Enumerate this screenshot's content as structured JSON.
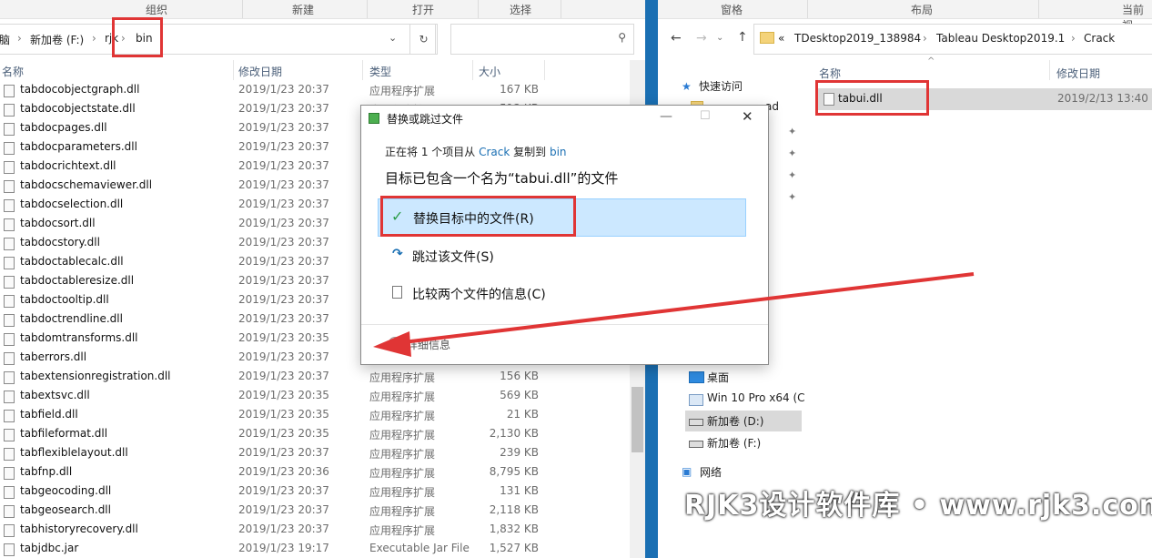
{
  "left_window": {
    "ribbon": [
      "组织",
      "新建",
      "打开",
      "选择"
    ],
    "breadcrumb": [
      "脑",
      "新加卷 (F:)",
      "rjk",
      "bin"
    ],
    "columns": {
      "name": "名称",
      "date": "修改日期",
      "type": "类型",
      "size": "大小"
    },
    "files": [
      {
        "name": "tabdocobjectgraph.dll",
        "date": "2019/1/23 20:37",
        "type": "应用程序扩展",
        "size": "167 KB"
      },
      {
        "name": "tabdocobjectstate.dll",
        "date": "2019/1/23 20:37",
        "type": "应用程序扩展",
        "size": "512 KB"
      },
      {
        "name": "tabdocpages.dll",
        "date": "2019/1/23 20:37",
        "type": "",
        "size": ""
      },
      {
        "name": "tabdocparameters.dll",
        "date": "2019/1/23 20:37",
        "type": "",
        "size": ""
      },
      {
        "name": "tabdocrichtext.dll",
        "date": "2019/1/23 20:37",
        "type": "",
        "size": ""
      },
      {
        "name": "tabdocschemaviewer.dll",
        "date": "2019/1/23 20:37",
        "type": "",
        "size": ""
      },
      {
        "name": "tabdocselection.dll",
        "date": "2019/1/23 20:37",
        "type": "",
        "size": ""
      },
      {
        "name": "tabdocsort.dll",
        "date": "2019/1/23 20:37",
        "type": "",
        "size": ""
      },
      {
        "name": "tabdocstory.dll",
        "date": "2019/1/23 20:37",
        "type": "",
        "size": ""
      },
      {
        "name": "tabdoctablecalc.dll",
        "date": "2019/1/23 20:37",
        "type": "",
        "size": ""
      },
      {
        "name": "tabdoctableresize.dll",
        "date": "2019/1/23 20:37",
        "type": "",
        "size": ""
      },
      {
        "name": "tabdoctooltip.dll",
        "date": "2019/1/23 20:37",
        "type": "",
        "size": ""
      },
      {
        "name": "tabdoctrendline.dll",
        "date": "2019/1/23 20:37",
        "type": "",
        "size": ""
      },
      {
        "name": "tabdomtransforms.dll",
        "date": "2019/1/23 20:35",
        "type": "",
        "size": ""
      },
      {
        "name": "taberrors.dll",
        "date": "2019/1/23 20:37",
        "type": "",
        "size": ""
      },
      {
        "name": "tabextensionregistration.dll",
        "date": "2019/1/23 20:37",
        "type": "应用程序扩展",
        "size": "156 KB"
      },
      {
        "name": "tabextsvc.dll",
        "date": "2019/1/23 20:35",
        "type": "应用程序扩展",
        "size": "569 KB"
      },
      {
        "name": "tabfield.dll",
        "date": "2019/1/23 20:35",
        "type": "应用程序扩展",
        "size": "21 KB"
      },
      {
        "name": "tabfileformat.dll",
        "date": "2019/1/23 20:35",
        "type": "应用程序扩展",
        "size": "2,130 KB"
      },
      {
        "name": "tabflexiblelayout.dll",
        "date": "2019/1/23 20:37",
        "type": "应用程序扩展",
        "size": "239 KB"
      },
      {
        "name": "tabfnp.dll",
        "date": "2019/1/23 20:36",
        "type": "应用程序扩展",
        "size": "8,795 KB"
      },
      {
        "name": "tabgeocoding.dll",
        "date": "2019/1/23 20:37",
        "type": "应用程序扩展",
        "size": "131 KB"
      },
      {
        "name": "tabgeosearch.dll",
        "date": "2019/1/23 20:37",
        "type": "应用程序扩展",
        "size": "2,118 KB"
      },
      {
        "name": "tabhistoryrecovery.dll",
        "date": "2019/1/23 20:37",
        "type": "应用程序扩展",
        "size": "1,832 KB"
      },
      {
        "name": "tabjdbc.jar",
        "date": "2019/1/23 19:17",
        "type": "Executable Jar File",
        "size": "1,527 KB"
      }
    ]
  },
  "right_window": {
    "ribbon": [
      "窗格",
      "布局",
      "当前视"
    ],
    "breadcrumb": [
      "«",
      "TDesktop2019_138984",
      "Tableau Desktop2019.1",
      "Crack"
    ],
    "columns": {
      "name": "名称",
      "date": "修改日期"
    },
    "file": {
      "name": "tabui.dll",
      "date": "2019/2/13 13:40"
    },
    "nav": {
      "quick_access": "快速访问",
      "pinned_partial": "ad",
      "desktop": "桌面",
      "win10": "Win 10 Pro x64 (C",
      "drive_d": "新加卷 (D:)",
      "drive_f": "新加卷 (F:)",
      "network": "网络"
    }
  },
  "dialog": {
    "title": "替换或跳过文件",
    "copy_prefix": "正在将 1 个项目从 ",
    "copy_source": "Crack",
    "copy_middle": " 复制到 ",
    "copy_dest": "bin",
    "heading": "目标已包含一个名为“tabui.dll”的文件",
    "option_replace": "替换目标中的文件(R)",
    "option_skip": "跳过该文件(S)",
    "option_compare": "比较两个文件的信息(C)",
    "details": "详细信息"
  },
  "watermark": "RJK3设计软件库 • www.rjk3.com",
  "colors": {
    "link": "#1a6fb3",
    "highlight": "#cce8ff",
    "annotation": "#e03535"
  }
}
